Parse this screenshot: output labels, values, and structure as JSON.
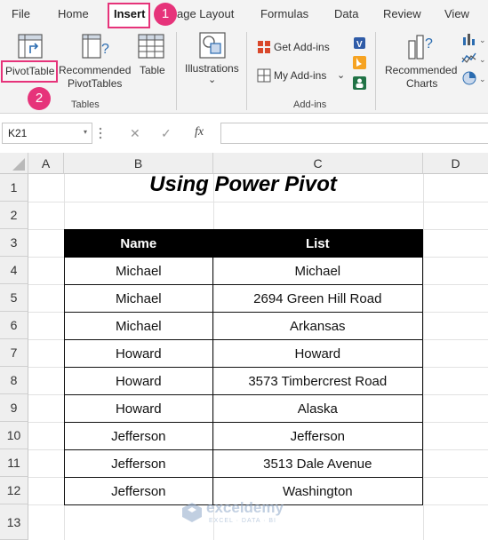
{
  "ribbon_tabs": [
    "File",
    "Home",
    "Insert",
    "age Layout",
    "Formulas",
    "Data",
    "Review",
    "View"
  ],
  "callouts": [
    "1",
    "2"
  ],
  "ribbon": {
    "pivottable": "PivotTable",
    "recommended_pivottables_1": "Recommended",
    "recommended_pivottables_2": "PivotTables",
    "table": "Table",
    "illustrations": "Illustrations",
    "illustrations_caret": "⌄",
    "get_addins": "Get Add-ins",
    "my_addins": "My Add-ins",
    "my_addins_caret": "⌄",
    "recommended_charts_1": "Recommended",
    "recommended_charts_2": "Charts",
    "group_tables": "Tables",
    "group_addins": "Add-ins"
  },
  "formula_bar": {
    "name_box": "K21",
    "name_caret": "▾",
    "cancel": "✕",
    "enter": "✓",
    "fx": "fx",
    "formula": ""
  },
  "columns": [
    "A",
    "B",
    "C",
    "D"
  ],
  "rows": [
    "1",
    "2",
    "3",
    "4",
    "5",
    "6",
    "7",
    "8",
    "9",
    "10",
    "11",
    "12",
    "13"
  ],
  "sheet": {
    "title": "Using Power Pivot",
    "headers": [
      "Name",
      "List"
    ],
    "data": [
      [
        "Michael",
        "Michael"
      ],
      [
        "Michael",
        "2694 Green Hill Road"
      ],
      [
        "Michael",
        "Arkansas"
      ],
      [
        "Howard",
        "Howard"
      ],
      [
        "Howard",
        "3573 Timbercrest Road"
      ],
      [
        "Howard",
        "Alaska"
      ],
      [
        "Jefferson",
        "Jefferson"
      ],
      [
        "Jefferson",
        "3513 Dale Avenue"
      ],
      [
        "Jefferson",
        "Washington"
      ]
    ]
  },
  "watermark": {
    "name": "exceldemy",
    "tagline": "EXCEL · DATA · BI"
  },
  "colors": {
    "callout": "#e6337a",
    "ribbon_bg": "#f3f3f3",
    "table_header_bg": "#000000",
    "excel_green": "#217346"
  }
}
